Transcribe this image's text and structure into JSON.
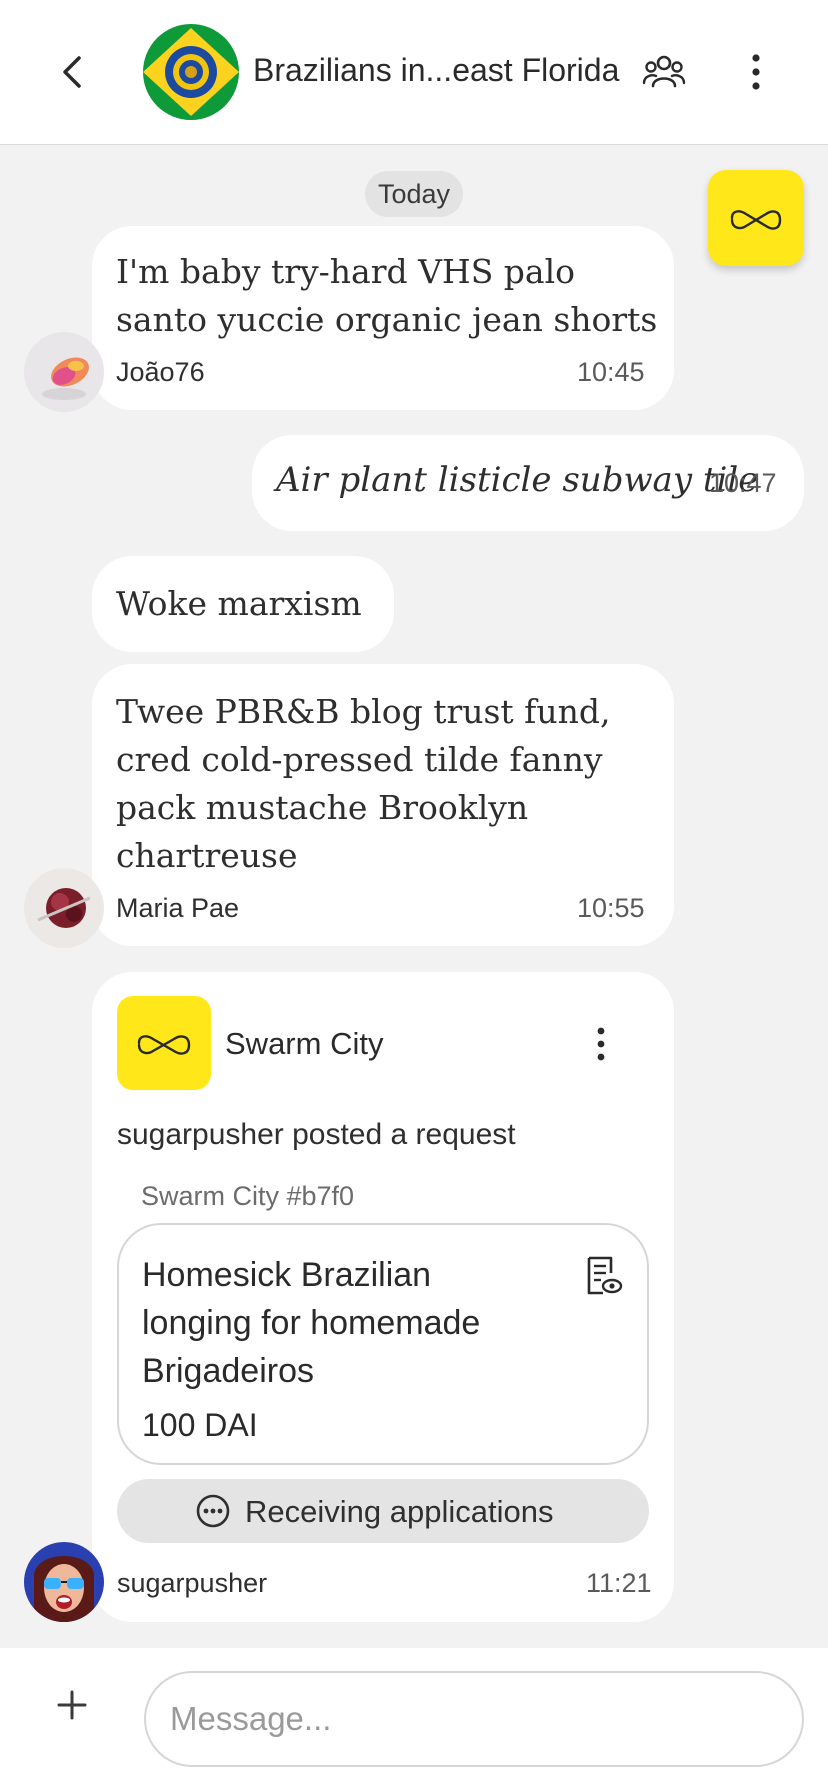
{
  "header": {
    "back_icon": "chevron-left-icon",
    "title": "Brazilians in...east Florida",
    "members_icon": "people-icon",
    "more_icon": "vertical-dots-icon",
    "avatar": "brazil-flag-avatar"
  },
  "chat": {
    "date_label": "Today",
    "messages": [
      {
        "text_line1": "I'm baby try-hard VHS palo",
        "text_line2": "santo yuccie organic jean shorts",
        "author": "João76",
        "time": "10:45",
        "incoming": true
      },
      {
        "text": "Air plant listicle subway tile",
        "time": "10:47",
        "incoming": false
      },
      {
        "text": "Woke marxism",
        "incoming": true
      },
      {
        "text_line1": "Twee PBR&B blog trust fund,",
        "text_line2": "cred cold-pressed tilde fanny",
        "text_line3": "pack mustache Brooklyn",
        "text_line4": "chartreuse",
        "author": "Maria Pae",
        "time": "10:55",
        "incoming": true
      }
    ]
  },
  "swarm_card": {
    "app_name": "Swarm City",
    "posted_text": "sugarpusher posted a request",
    "reference": "Swarm City #b7f0",
    "request": {
      "title_line1": "Homesick Brazilian",
      "title_line2": "longing for homemade",
      "title_line3": "Brigadeiros",
      "amount": "100 DAI",
      "icon": "document-view-icon"
    },
    "status": "Receiving applications",
    "status_icon": "dots-circle-icon",
    "author": "sugarpusher",
    "time": "11:21"
  },
  "composer": {
    "plus_label": "+",
    "placeholder": "Message..."
  },
  "colors": {
    "brand_yellow": "#ffe71a",
    "background": "#f2f2f2",
    "bubble": "#ffffff"
  }
}
